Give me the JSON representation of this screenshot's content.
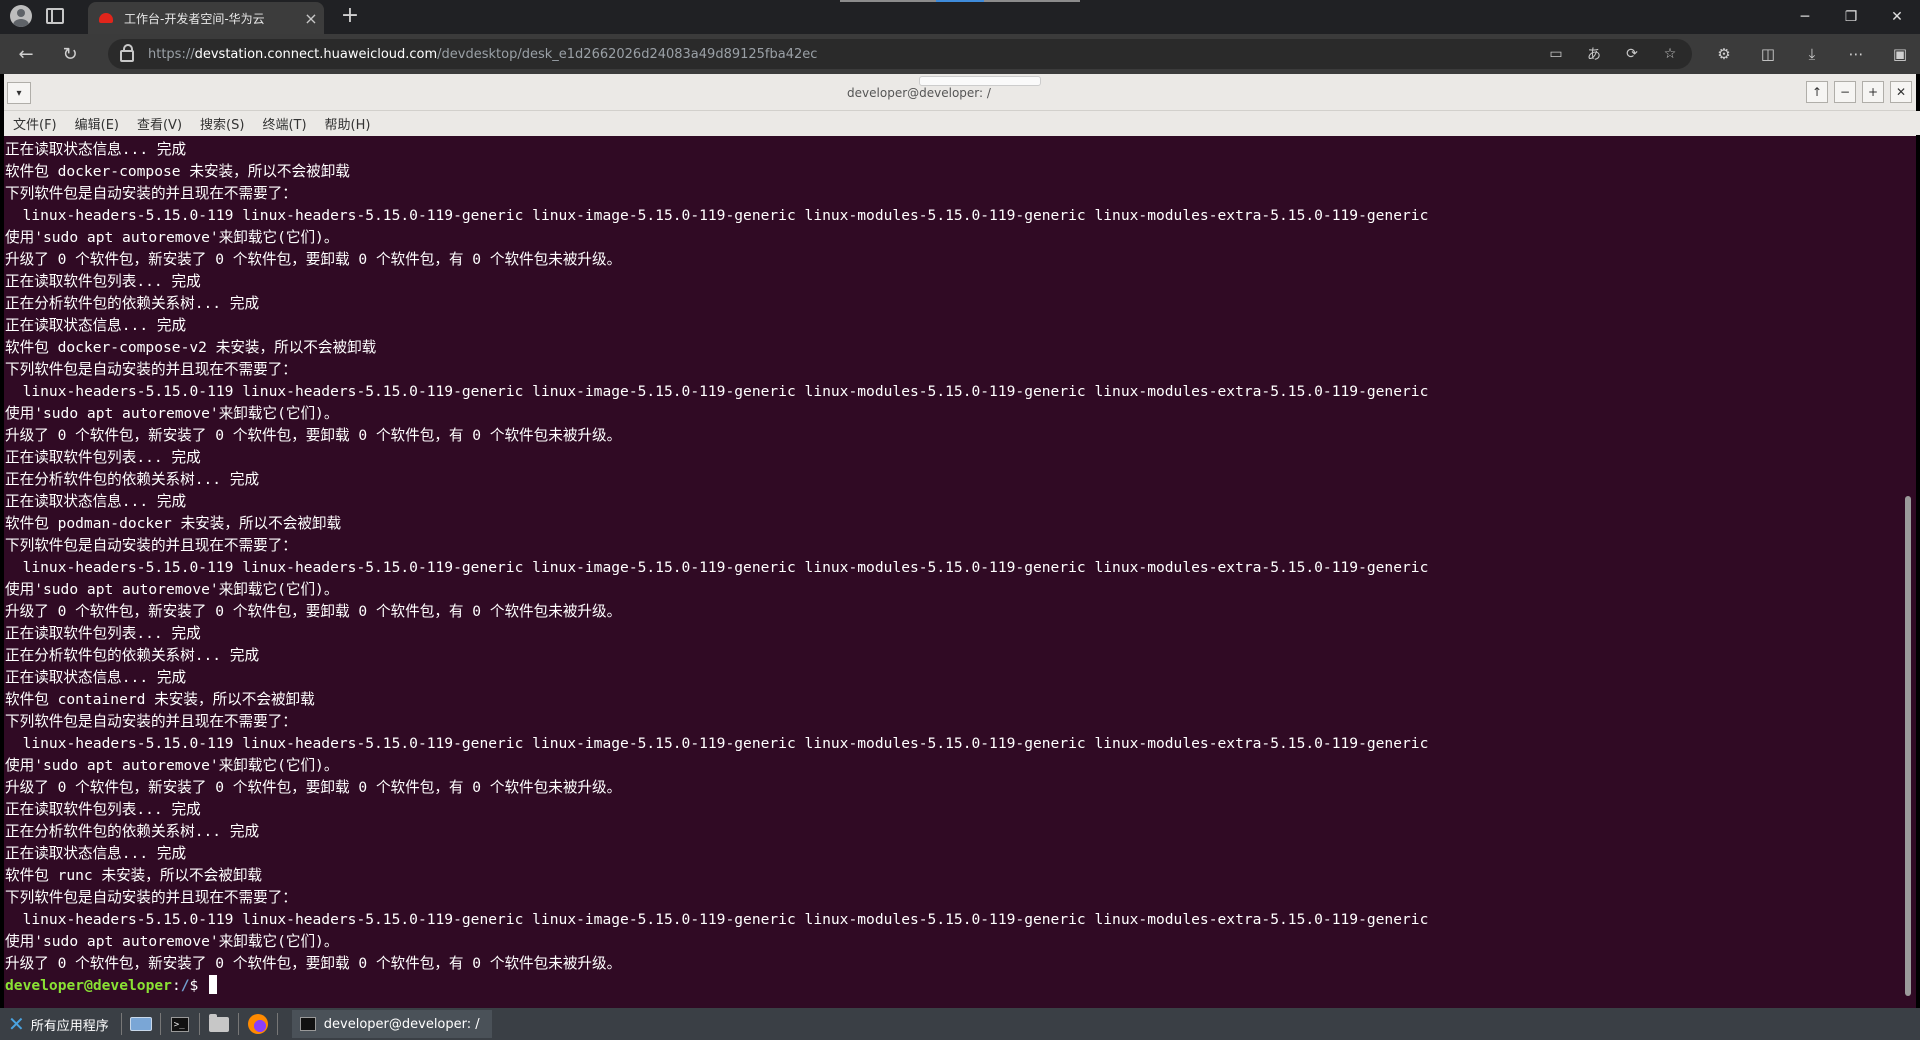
{
  "browser": {
    "tab_title": "工作台-开发者空间-华为云",
    "url_prefix": "https://",
    "url_host": "devstation.connect.huaweicloud.com",
    "url_path": "/devdesktop/desk_e1d2662026d24083a49d89125fba42ec",
    "new_tab_symbol": "+",
    "tab_close_symbol": "×"
  },
  "terminal": {
    "title": "developer@developer: /",
    "menu": [
      "文件(F)",
      "编辑(E)",
      "查看(V)",
      "搜索(S)",
      "终端(T)",
      "帮助(H)"
    ],
    "lines": [
      "正在读取状态信息... 完成",
      "软件包 docker-compose 未安装，所以不会被卸载",
      "下列软件包是自动安装的并且现在不需要了：",
      "  linux-headers-5.15.0-119 linux-headers-5.15.0-119-generic linux-image-5.15.0-119-generic linux-modules-5.15.0-119-generic linux-modules-extra-5.15.0-119-generic",
      "使用'sudo apt autoremove'来卸载它(它们)。",
      "升级了 0 个软件包，新安装了 0 个软件包，要卸载 0 个软件包，有 0 个软件包未被升级。",
      "正在读取软件包列表... 完成",
      "正在分析软件包的依赖关系树... 完成",
      "正在读取状态信息... 完成",
      "软件包 docker-compose-v2 未安装，所以不会被卸载",
      "下列软件包是自动安装的并且现在不需要了：",
      "  linux-headers-5.15.0-119 linux-headers-5.15.0-119-generic linux-image-5.15.0-119-generic linux-modules-5.15.0-119-generic linux-modules-extra-5.15.0-119-generic",
      "使用'sudo apt autoremove'来卸载它(它们)。",
      "升级了 0 个软件包，新安装了 0 个软件包，要卸载 0 个软件包，有 0 个软件包未被升级。",
      "正在读取软件包列表... 完成",
      "正在分析软件包的依赖关系树... 完成",
      "正在读取状态信息... 完成",
      "软件包 podman-docker 未安装，所以不会被卸载",
      "下列软件包是自动安装的并且现在不需要了：",
      "  linux-headers-5.15.0-119 linux-headers-5.15.0-119-generic linux-image-5.15.0-119-generic linux-modules-5.15.0-119-generic linux-modules-extra-5.15.0-119-generic",
      "使用'sudo apt autoremove'来卸载它(它们)。",
      "升级了 0 个软件包，新安装了 0 个软件包，要卸载 0 个软件包，有 0 个软件包未被升级。",
      "正在读取软件包列表... 完成",
      "正在分析软件包的依赖关系树... 完成",
      "正在读取状态信息... 完成",
      "软件包 containerd 未安装，所以不会被卸载",
      "下列软件包是自动安装的并且现在不需要了：",
      "  linux-headers-5.15.0-119 linux-headers-5.15.0-119-generic linux-image-5.15.0-119-generic linux-modules-5.15.0-119-generic linux-modules-extra-5.15.0-119-generic",
      "使用'sudo apt autoremove'来卸载它(它们)。",
      "升级了 0 个软件包，新安装了 0 个软件包，要卸载 0 个软件包，有 0 个软件包未被升级。",
      "正在读取软件包列表... 完成",
      "正在分析软件包的依赖关系树... 完成",
      "正在读取状态信息... 完成",
      "软件包 runc 未安装，所以不会被卸载",
      "下列软件包是自动安装的并且现在不需要了：",
      "  linux-headers-5.15.0-119 linux-headers-5.15.0-119-generic linux-image-5.15.0-119-generic linux-modules-5.15.0-119-generic linux-modules-extra-5.15.0-119-generic",
      "使用'sudo apt autoremove'来卸载它(它们)。",
      "升级了 0 个软件包，新安装了 0 个软件包，要卸载 0 个软件包，有 0 个软件包未被升级。"
    ],
    "prompt_user": "developer@developer",
    "prompt_sep": ":",
    "prompt_path": "/",
    "prompt_symbol": "$ "
  },
  "taskbar": {
    "apps_label": "所有应用程序",
    "window_label": "developer@developer: /"
  },
  "colors": {
    "terminal_bg": "#300a24",
    "prompt_user": "#8ae234",
    "prompt_path": "#729fcf",
    "taskbar_bg": "#3a3f45"
  },
  "icons": [
    "profile-icon",
    "tabs-icon",
    "favicon-icon",
    "back-icon",
    "reload-icon",
    "lock-icon",
    "reader-icon",
    "translate-icon",
    "refresh-icon",
    "star-icon",
    "extensions-icon",
    "split-icon",
    "download-icon",
    "more-icon",
    "sidebar-icon",
    "apps-icon",
    "keyboard-icon",
    "terminal-icon",
    "folder-icon",
    "firefox-icon"
  ]
}
